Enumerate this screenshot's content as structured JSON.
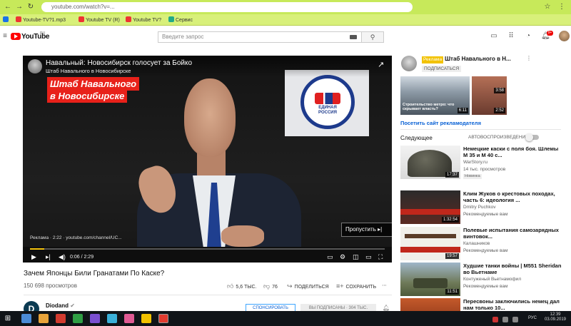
{
  "browser": {
    "url": "youtube.com/watch?v=...",
    "bookmarks": [
      "",
      "Youtube-TV?1.mp3",
      "Youtube TV (R)",
      "Youtube TV?",
      "Сервис",
      "",
      "",
      "",
      "",
      ""
    ]
  },
  "header": {
    "logo_text": "YouTube",
    "region": "RU",
    "search_placeholder": "Введите запрос",
    "notification_count": "9+"
  },
  "player": {
    "overlay_title": "Навальный: Новосибирск голосует за Бойко",
    "overlay_channel": "Штаб Навального в Новосибирске",
    "banner_line1": "Штаб Навального",
    "banner_line2": "в Новосибирске",
    "party_logo_text": "ЕДИНАЯ РОССИЯ",
    "ad_info": "Реклама · 2:22 · youtube.com/channel/UC...",
    "skip_label": "Пропустить ▸|",
    "time": "0:06 / 2:29",
    "progress_fraction": 0.04
  },
  "video": {
    "title": "Зачем Японцы Били Гранатами По Каске?",
    "views": "150 698 просмотров",
    "likes": "5,6 ТЫС.",
    "dislikes": "76",
    "share": "ПОДЕЛИТЬСЯ",
    "save": "СОХРАНИТЬ",
    "channel": "Diodand",
    "sponsor": "СПОНСИРОВАТЬ",
    "subscribed": "ВЫ ПОДПИСАНЫ · 304 ТЫС."
  },
  "sidebar_ad": {
    "badge": "Реклама",
    "channel": "Штаб Навального в Н...",
    "subscribe": "ПОДПИСАТЬСЯ",
    "thumb1_caption": "Строительство метро: что скрывает власть?",
    "thumb1_duration": "6:11",
    "thumb2_duration_a": "3:58",
    "thumb2_duration_b": "2:52",
    "link": "Посетить сайт рекламодателя"
  },
  "up_next": {
    "label": "Следующее",
    "autoplay": "АВТОВОСПРОИЗВЕДЕНИЕ",
    "items": [
      {
        "title": "Немецкие каски с поля боя. Шлемы М 35 и М 40 с...",
        "channel": "WarStory.ru",
        "meta": "14 тыс. просмотров",
        "badge": "Новинка",
        "duration": "17:37"
      },
      {
        "title": "Клим Жуков о крестовых походах, часть 6: идеология ...",
        "channel": "Dmitry Puchkov",
        "meta": "Рекомендуемые вам",
        "badge": "",
        "duration": "1:32:54"
      },
      {
        "title": "Полевые испытания самозарядных винтовок...",
        "channel": "Калашников",
        "meta": "Рекомендуемые вам",
        "badge": "",
        "duration": "19:57"
      },
      {
        "title": "Худшие танки войны | M551 Sheridan во Вьетнаме",
        "channel": "Контуженый Вьетнамофил",
        "meta": "Рекомендуемые вам",
        "badge": "",
        "duration": "11:51"
      },
      {
        "title": "Пересвоны заключились немец дал нам только 10...",
        "channel": "",
        "meta": "",
        "badge": "",
        "duration": ""
      }
    ]
  },
  "taskbar": {
    "lang": "РУС",
    "time": "12:39",
    "date": "03.09.2019"
  }
}
